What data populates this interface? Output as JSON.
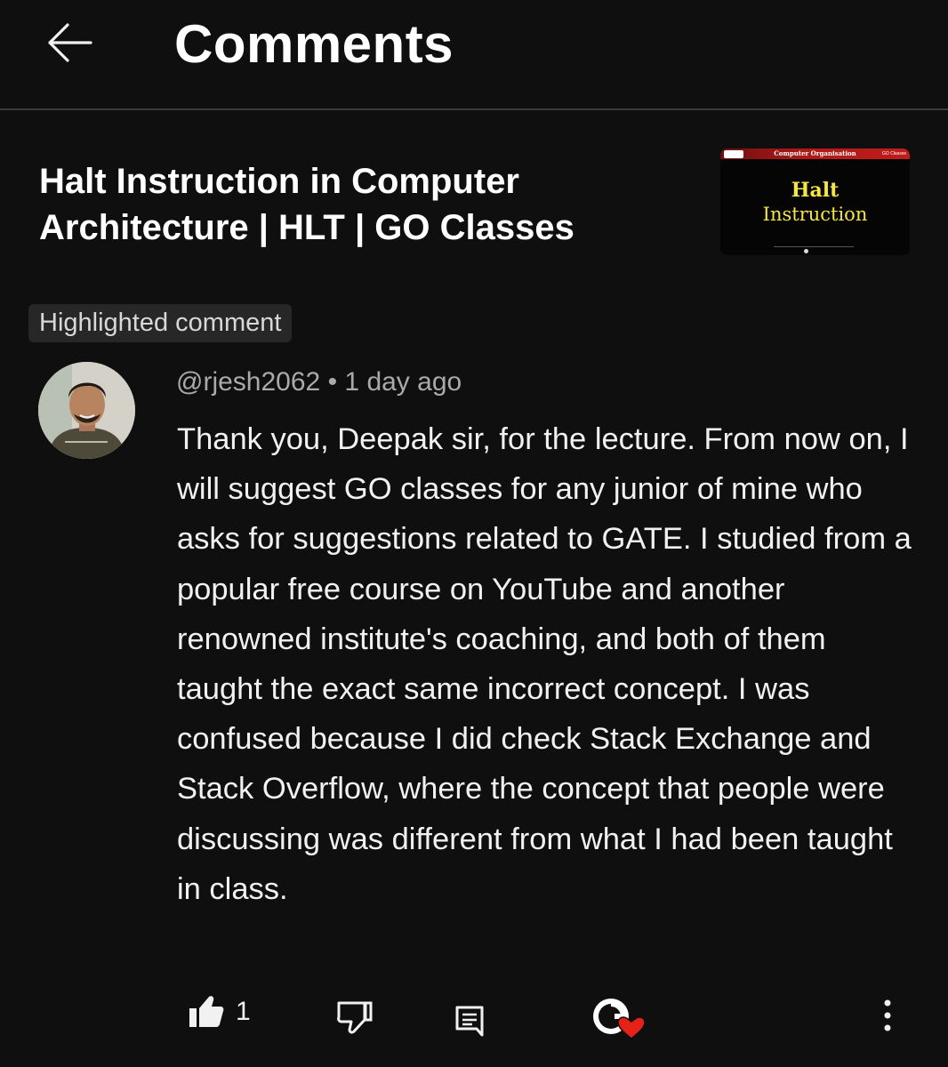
{
  "header": {
    "title": "Comments"
  },
  "video": {
    "title": "Halt Instruction in Computer Architecture | HLT | GO Classes",
    "thumbnail": {
      "course": "Computer Organisation",
      "brand": "GO Classes",
      "line1": "Halt",
      "line2": "Instruction"
    }
  },
  "highlight_label": "Highlighted comment",
  "comment": {
    "author": "@rjesh2062",
    "separator": "•",
    "time": "1 day ago",
    "text": "Thank you, Deepak sir, for the lecture. From now on, I will suggest GO classes for any junior of mine who asks for suggestions related to GATE. I studied from a popular free course on YouTube and another renowned institute's coaching, and both of them taught the exact same incorrect concept. I was confused because I did check Stack Exchange and Stack Overflow, where the concept that people were discussing was different from what I had been taught in class.",
    "likes": "1"
  },
  "icons": {
    "back": "arrow-left-icon",
    "like": "thumbs-up-icon",
    "dislike": "thumbs-down-icon",
    "reply": "comment-reply-icon",
    "creator_heart": "creator-heart-icon",
    "more": "more-vertical-icon"
  },
  "colors": {
    "background": "#0f0f0f",
    "text": "#f1f1f1",
    "meta": "#aaaaaa",
    "chip": "#272727",
    "heart": "#e62117",
    "thumb_text": "#f5e642"
  }
}
